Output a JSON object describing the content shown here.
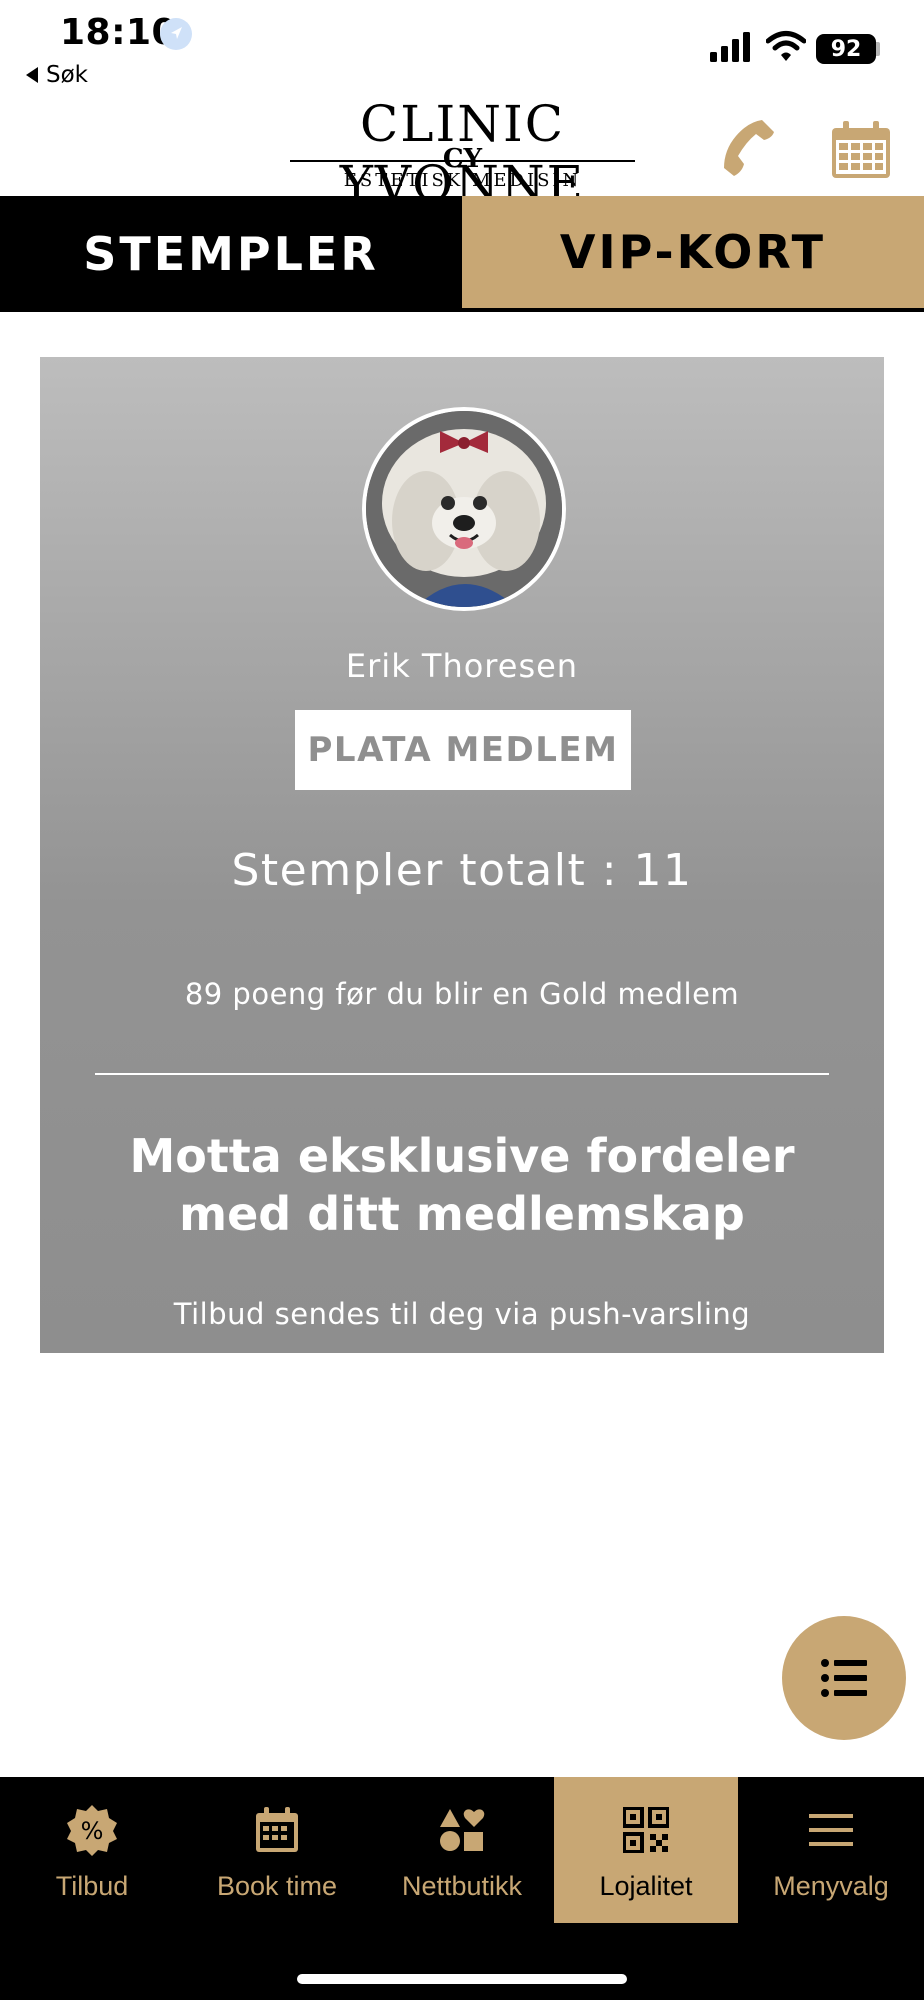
{
  "status_bar": {
    "time": "18:10",
    "back_label": "Søk",
    "battery": "92"
  },
  "header": {
    "logo_main": "CLINIC YVONNE",
    "logo_monogram": "CY",
    "logo_sub": "ESTETISK MEDISIN",
    "phone_icon": "phone-icon",
    "calendar_icon": "calendar-icon"
  },
  "tabs": [
    {
      "label": "STEMPLER",
      "active": false
    },
    {
      "label": "VIP-KORT",
      "active": true
    }
  ],
  "card": {
    "name": "Erik Thoresen",
    "badge": "PLATA MEDLEM",
    "stamps_total": "Stempler totalt : 11",
    "points_text": "89 poeng før du blir en Gold medlem",
    "benefits_heading": "Motta eksklusive fordeler med ditt medlemskap",
    "benefits_sub": "Tilbud sendes til deg via push-varsling"
  },
  "fab": {
    "icon": "list-icon"
  },
  "bottom_nav": [
    {
      "label": "Tilbud",
      "icon": "percent-badge-icon"
    },
    {
      "label": "Book time",
      "icon": "calendar-icon"
    },
    {
      "label": "Nettbutikk",
      "icon": "shapes-icon"
    },
    {
      "label": "Lojalitet",
      "icon": "qr-code-icon",
      "active": true
    },
    {
      "label": "Menyvalg",
      "icon": "hamburger-icon"
    }
  ],
  "colors": {
    "accent": "#c8a774",
    "dark": "#000000",
    "card_top": "#bdbdbd",
    "card_bottom": "#8e8e8e"
  }
}
